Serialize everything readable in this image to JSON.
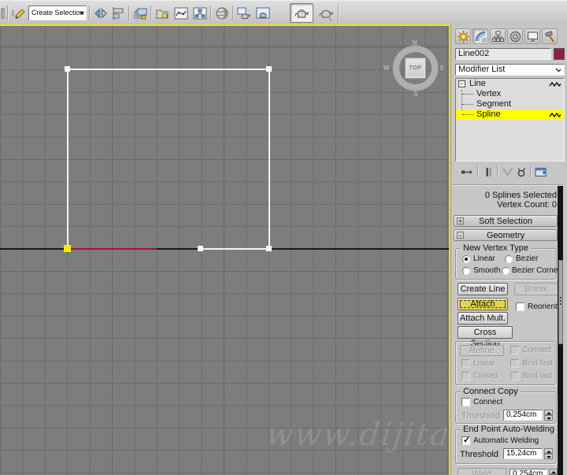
{
  "toolbar": {
    "create_selection_set": {
      "value": "Create Selection Se"
    },
    "icon_names": [
      "edit-named-selection-sets",
      "mirror",
      "align",
      "layer-manager",
      "scene-container",
      "curve-editor",
      "schematic-view",
      "material-editor",
      "render-setup",
      "rendered-frame-window",
      "render-production",
      "render-iterative"
    ]
  },
  "viewport": {
    "viewcube": {
      "face_label": "TOP",
      "compass": {
        "n": "N",
        "e": "E",
        "s": "S",
        "w": "W"
      }
    },
    "watermark": "www.dijitalde",
    "colors": {
      "background": "#7d7d7d",
      "grid_line": "#6d6d6d",
      "axis": "#181818",
      "spline_selected": "#f2f2f2",
      "spline_segment_red": "#a01040",
      "first_vertex": "#f6ee00"
    }
  },
  "panel": {
    "tab_names": [
      "create",
      "modify",
      "hierarchy",
      "motion",
      "display",
      "utilities"
    ],
    "active_tab": "modify",
    "object_name": "Line002",
    "object_color": "#8e1c49",
    "modifier_list": {
      "label": "Modifier List"
    },
    "stack": {
      "root": "Line",
      "items": [
        "Vertex",
        "Segment",
        "Spline"
      ],
      "selected": "Spline",
      "highlight_color": "#ffff00"
    },
    "stack_tool_names": [
      "pin-stack",
      "show-end-result",
      "make-unique",
      "remove-modifier",
      "configure-modifier-sets"
    ],
    "selection_info": {
      "line1": "0 Splines Selected",
      "line2": "Vertex Count: 0"
    },
    "rollouts": [
      {
        "title": "Soft Selection",
        "state": "+"
      },
      {
        "title": "Geometry",
        "state": "-"
      }
    ],
    "geometry": {
      "new_vertex_type": {
        "title": "New Vertex Type",
        "options": [
          "Linear",
          "Bezier",
          "Smooth",
          "Bezier Corner"
        ],
        "selected": "Linear"
      },
      "create_line": "Create Line",
      "break": "Break",
      "attach": "Attach",
      "attach_active": true,
      "reorient": "Reorient",
      "attach_mult": "Attach Mult.",
      "cross_section": "Cross Section",
      "refine": "Refine",
      "connect": "Connect",
      "linear": "Linear",
      "bind_first": "Bind first",
      "closed": "Closed",
      "bind_last": "Bind last",
      "connect_copy": {
        "title": "Connect Copy",
        "connect": "Connect",
        "threshold_label": "Threshold",
        "threshold_value": "0,254cm"
      },
      "end_point": {
        "title": "End Point Auto-Welding",
        "auto_weld_label": "Automatic Welding",
        "auto_weld_checked": true,
        "threshold_label": "Threshold",
        "threshold_value": "15,24cm"
      },
      "weld": {
        "label": "Weld",
        "value": "0,254cm"
      },
      "active_button_color": "#e5d24e"
    }
  },
  "glyphs": {
    "expand_minus": "-",
    "check": "✓"
  }
}
